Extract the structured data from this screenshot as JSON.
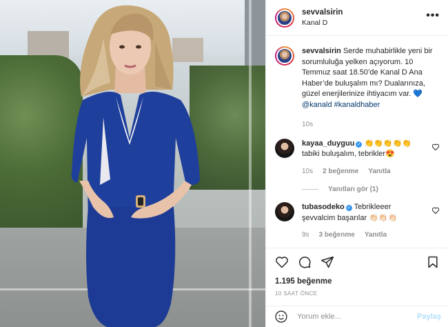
{
  "post": {
    "author": "sevvalsirin",
    "location": "Kanal D",
    "more_icon": "more-dots-icon",
    "caption_text": "Serde muhabirlikle yeni bir sorumluluğa yelken açıyorum. 10 Temmuz saat 18.50’de Kanal D Ana Haber’de buluşalım mı? Dualarınıza, güzel enerjilerinize ihtiyacım var. 💙",
    "caption_tags": "@kanald #kanaldhaber",
    "caption_time": "10s"
  },
  "comments": [
    {
      "username": "kayaa_duyguu",
      "emoji": "👏👏👏👏👏",
      "text": "tabiki buluşalım, tebrikler😍",
      "time": "10s",
      "likes": "2 beğenme",
      "reply": "Yanıtla",
      "view_replies": "Yanıtları gör (1)"
    },
    {
      "username": "tubasodeko",
      "text_line1": "Tebrikleeer",
      "text_line2": "şevvalcim başarılar 👏🏻👏🏻👏🏻",
      "time": "9s",
      "likes": "3 beğenme",
      "reply": "Yanıtla"
    }
  ],
  "actions": {
    "likes": "1.195 beğenme",
    "posted": "10 SAAT ÖNCE"
  },
  "add_comment": {
    "placeholder": "Yorum ekle...",
    "post_label": "Paylaş"
  },
  "colors": {
    "verified": "#3897f0",
    "link": "#00376b",
    "muted": "#8e8e8e",
    "post_disabled": "#b2dffc",
    "blazer": "#1f3f9c"
  }
}
